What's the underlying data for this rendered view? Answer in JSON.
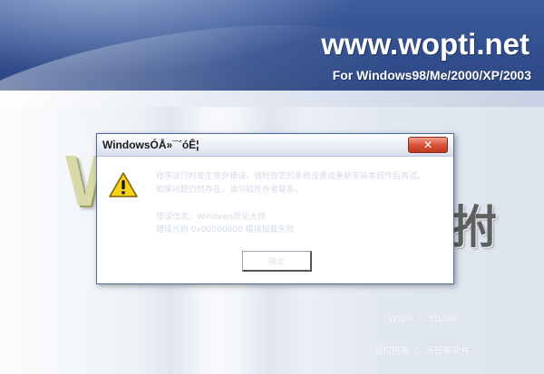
{
  "background": {
    "site": "www.wopti.net",
    "platforms": "For Windows98/Me/2000/XP/2003",
    "letter_left": "W",
    "glyph_right": "拊",
    "faint_line_1": "Wopti ©  Studio",
    "faint_line_2": "版权所有 ©  沃普蒂软件"
  },
  "dialog": {
    "title": "WindowsÓÅ»¯´óÊ¦",
    "close_glyph": "✕",
    "message_line_1": "程序运行时发生意外错误，请检查您的系统设置或重新安装本软件后再试。",
    "message_line_2": "如果问题仍然存在，请与软件作者联系。",
    "message_line_3": "错误信息：Windows优化大师",
    "message_line_4": "错误代码 0x00000000 模块加载失败",
    "ok_label": "确定",
    "icon": "warning-icon"
  }
}
